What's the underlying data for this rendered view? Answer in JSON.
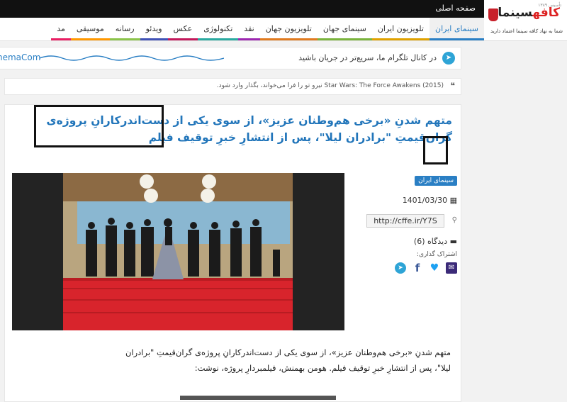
{
  "topbar": {
    "home_label": "صفحه اصلی"
  },
  "logo": {
    "name_black": "سینما",
    "name_red": "کافه",
    "since": "تأسیس ۱۳۸۹",
    "tagline": "شما به نهاد کافه سینما اعتماد دارید"
  },
  "nav": {
    "items": [
      {
        "label": "سینمای ایران",
        "active": true,
        "color": "#2a7fc4"
      },
      {
        "label": "تلویزیون ایران",
        "color": "#e0a100"
      },
      {
        "label": "سینمای جهان",
        "color": "#7ab33c"
      },
      {
        "label": "تلویزیون جهان",
        "color": "#e07a1f"
      },
      {
        "label": "نقد",
        "color": "#9c27b0"
      },
      {
        "label": "تکنولوژی",
        "color": "#2aa9a0"
      },
      {
        "label": "عکس",
        "color": "#c2185b"
      },
      {
        "label": "ویدئو",
        "color": "#3f51b5"
      },
      {
        "label": "رسانه",
        "color": "#8bc34a"
      },
      {
        "label": "موسیقی",
        "color": "#ff9800"
      },
      {
        "label": "مد",
        "color": "#e91e63"
      }
    ]
  },
  "telegram": {
    "site_name": "nemaCom",
    "message": "در کانال تلگرام ما، سریع‌تر در جریان باشید"
  },
  "ticker": {
    "text": "Star Wars: The Force Awakens (2015) نیرو تو را فرا می‌خواند، بگذار وارد شود."
  },
  "article": {
    "headline": "متهم شدنِ «برخی هم‌وطنان عزیز»، از سوی یکی از دست‌اندرکارانِ پروژه‌ی گران‌قیمتِ \"برادران لیلا\"، پس از انتشارِ خبرِ توقیف فیلم",
    "category": "سینمای ایران",
    "date": "1401/03/30",
    "short_url": "http://cffe.ir/Y7S",
    "views": "دیدگاه (6)",
    "share_label": "اشتراک گذاری:",
    "body": "متهم شدنِ «برخی هم‌وطنان عزیز»، از سوی یکی از دست‌اندرکارانِ پروژه‌ی گران‌قیمتِ \"برادران لیلا\"، پس از انتشارِ خبرِ توقیف فیلم. هومن بهمنش، فیلمبردارِ پروژه، نوشت:"
  },
  "icons": {
    "telegram": "telegram-icon",
    "facebook": "facebook-icon",
    "twitter": "twitter-icon",
    "email": "email-icon",
    "calendar": "calendar-icon",
    "link": "link-icon",
    "comment": "comment-icon",
    "quote": "quote-icon"
  }
}
